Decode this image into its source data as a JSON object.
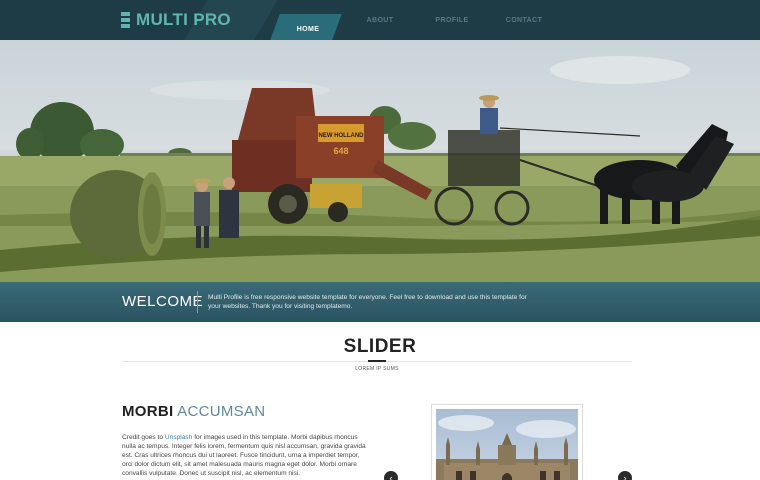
{
  "header": {
    "logo_text": "MULTI PRO",
    "nav": [
      {
        "label": "HOME",
        "active": true
      },
      {
        "label": "ABOUT",
        "active": false
      },
      {
        "label": "PROFILE",
        "active": false
      },
      {
        "label": "CONTACT",
        "active": false
      }
    ]
  },
  "hero": {
    "baler_brand": "NEW HOLLAND",
    "baler_model": "648"
  },
  "welcome": {
    "title": "WELCOME",
    "text": "Multi Profile is free responsive website template for everyone. Feel free to download and use this template for your websites. Thank you for visiting templatemo."
  },
  "slider": {
    "title": "SLIDER",
    "subtitle": "LOREM IP SUMS"
  },
  "content": {
    "heading_strong": "MORBI",
    "heading_light": "ACCUMSAN",
    "text_prefix": "Credit goes to ",
    "text_link": "Unsplash",
    "text_suffix": " for images used in this template. Morbi dapibus rhoncus nulla ac tempus. Integer felis lorem, fermentum quis nisl accumsan, gravida gravida est. Cras ultrices rhoncus dui ut laoreet. Fusce tincidunt, urna a imperdiet tempor, orci dolor dictum elit, sit amet malesuada mauris magna eget dolor. Morbi ornare convallis vulputate. Donec ut suscipit nisl, ac elementum nisi."
  },
  "slider_controls": {
    "prev_icon": "‹",
    "next_icon": "›"
  },
  "colors": {
    "header_bg": "#1d3c46",
    "accent": "#5fb6b0",
    "nav_active": "#2a6c79",
    "welcome_bg": "#2f5b69",
    "heading_light": "#5d8a97",
    "link": "#3f7fa6"
  }
}
